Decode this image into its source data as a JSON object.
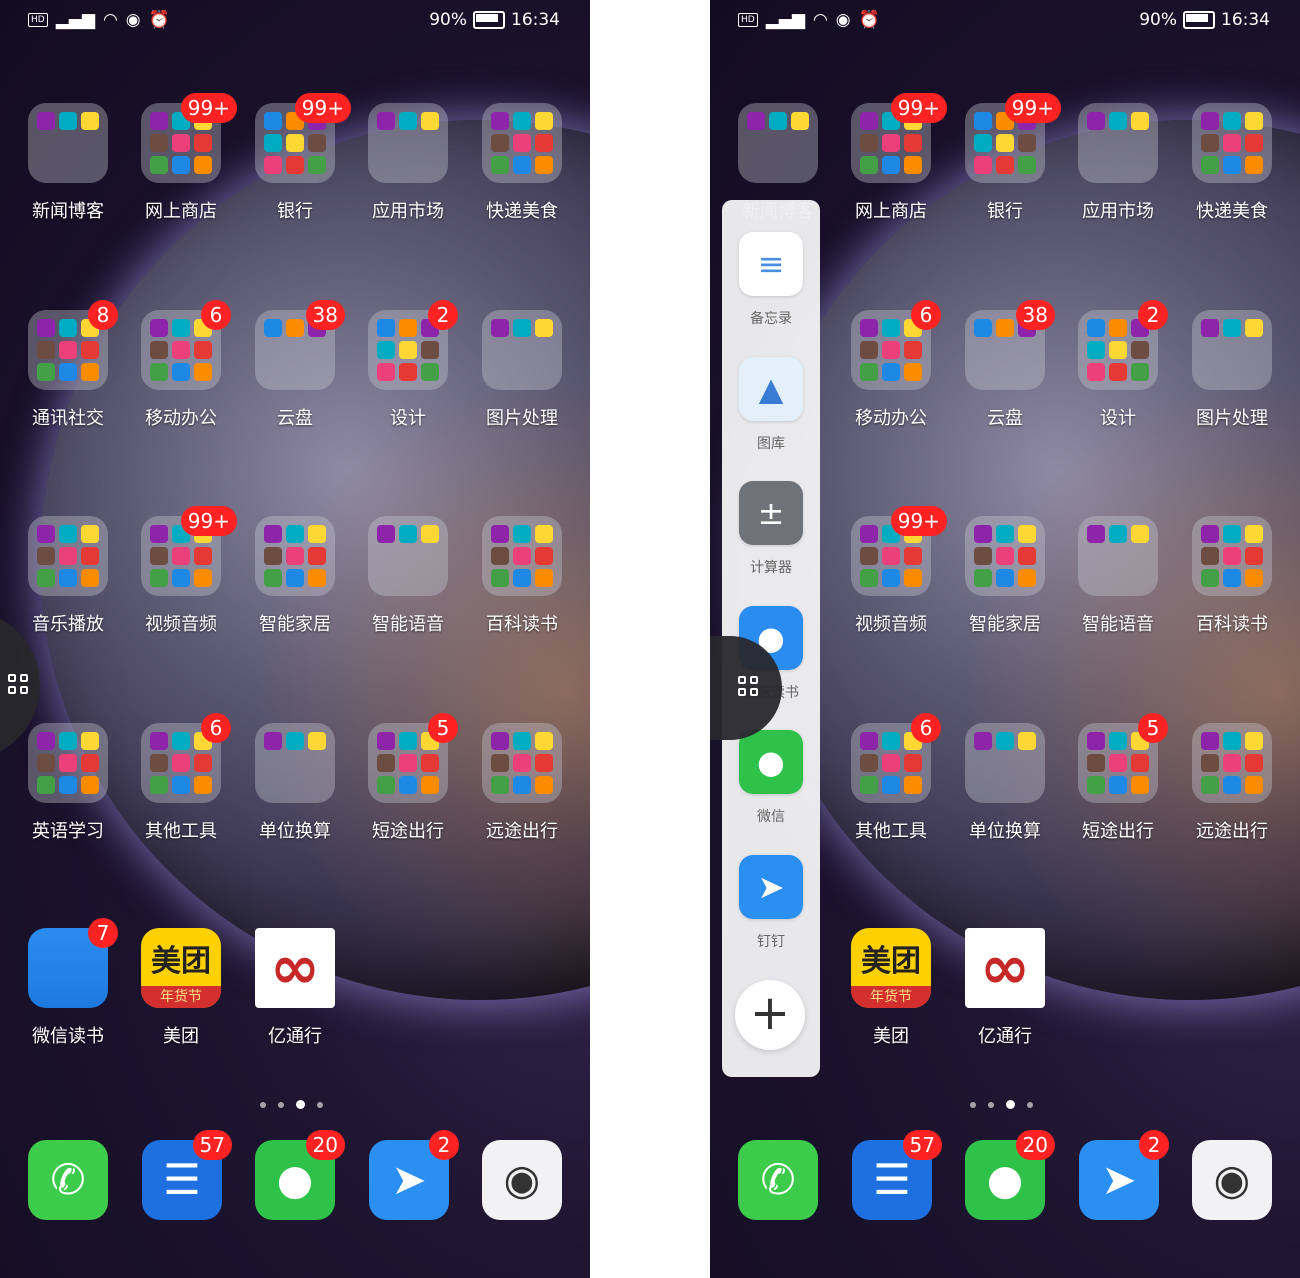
{
  "status": {
    "battery": "90%",
    "time": "16:34"
  },
  "left_screen": {
    "apps": [
      {
        "label": "新闻博客",
        "badge": ""
      },
      {
        "label": "网上商店",
        "badge": "99+"
      },
      {
        "label": "银行",
        "badge": "99+"
      },
      {
        "label": "应用市场",
        "badge": ""
      },
      {
        "label": "快递美食",
        "badge": ""
      },
      {
        "label": "通讯社交",
        "badge": "8"
      },
      {
        "label": "移动办公",
        "badge": "6"
      },
      {
        "label": "云盘",
        "badge": "38"
      },
      {
        "label": "设计",
        "badge": "2"
      },
      {
        "label": "图片处理",
        "badge": ""
      },
      {
        "label": "音乐播放",
        "badge": ""
      },
      {
        "label": "视频音频",
        "badge": "99+"
      },
      {
        "label": "智能家居",
        "badge": ""
      },
      {
        "label": "智能语音",
        "badge": ""
      },
      {
        "label": "百科读书",
        "badge": ""
      },
      {
        "label": "英语学习",
        "badge": ""
      },
      {
        "label": "其他工具",
        "badge": "6"
      },
      {
        "label": "单位换算",
        "badge": ""
      },
      {
        "label": "短途出行",
        "badge": "5"
      },
      {
        "label": "远途出行",
        "badge": ""
      },
      {
        "label": "微信读书",
        "badge": "7"
      },
      {
        "label": "美团",
        "badge": ""
      },
      {
        "label": "亿通行",
        "badge": ""
      }
    ],
    "dock": [
      {
        "name": "phone",
        "badge": ""
      },
      {
        "name": "messages",
        "badge": "57"
      },
      {
        "name": "wechat",
        "badge": "20"
      },
      {
        "name": "dingtalk",
        "badge": "2"
      },
      {
        "name": "camera",
        "badge": ""
      }
    ]
  },
  "right_screen": {
    "apps": [
      {
        "label": "新闻博客",
        "badge": ""
      },
      {
        "label": "网上商店",
        "badge": "99+"
      },
      {
        "label": "银行",
        "badge": "99+"
      },
      {
        "label": "应用市场",
        "badge": ""
      },
      {
        "label": "快递美食",
        "badge": ""
      },
      {
        "label": "移动办公",
        "badge": "6"
      },
      {
        "label": "云盘",
        "badge": "38"
      },
      {
        "label": "设计",
        "badge": "2"
      },
      {
        "label": "图片处理",
        "badge": ""
      },
      {
        "label": "视频音频",
        "badge": "99+"
      },
      {
        "label": "智能家居",
        "badge": ""
      },
      {
        "label": "智能语音",
        "badge": ""
      },
      {
        "label": "百科读书",
        "badge": ""
      },
      {
        "label": "其他工具",
        "badge": "6"
      },
      {
        "label": "单位换算",
        "badge": ""
      },
      {
        "label": "短途出行",
        "badge": "5"
      },
      {
        "label": "远途出行",
        "badge": ""
      },
      {
        "label": "美团",
        "badge": ""
      },
      {
        "label": "亿通行",
        "badge": ""
      }
    ],
    "side_dock": [
      {
        "label": "备忘录"
      },
      {
        "label": "图库"
      },
      {
        "label": "计算器"
      },
      {
        "label": "微信读书"
      },
      {
        "label": "微信"
      },
      {
        "label": "钉钉"
      }
    ],
    "add_symbol": "+",
    "dock": [
      {
        "badge": ""
      },
      {
        "badge": "57"
      },
      {
        "badge": "20"
      },
      {
        "badge": "2"
      },
      {
        "badge": ""
      }
    ]
  },
  "meituan_text": "美团",
  "meituan_sub": "年货节"
}
